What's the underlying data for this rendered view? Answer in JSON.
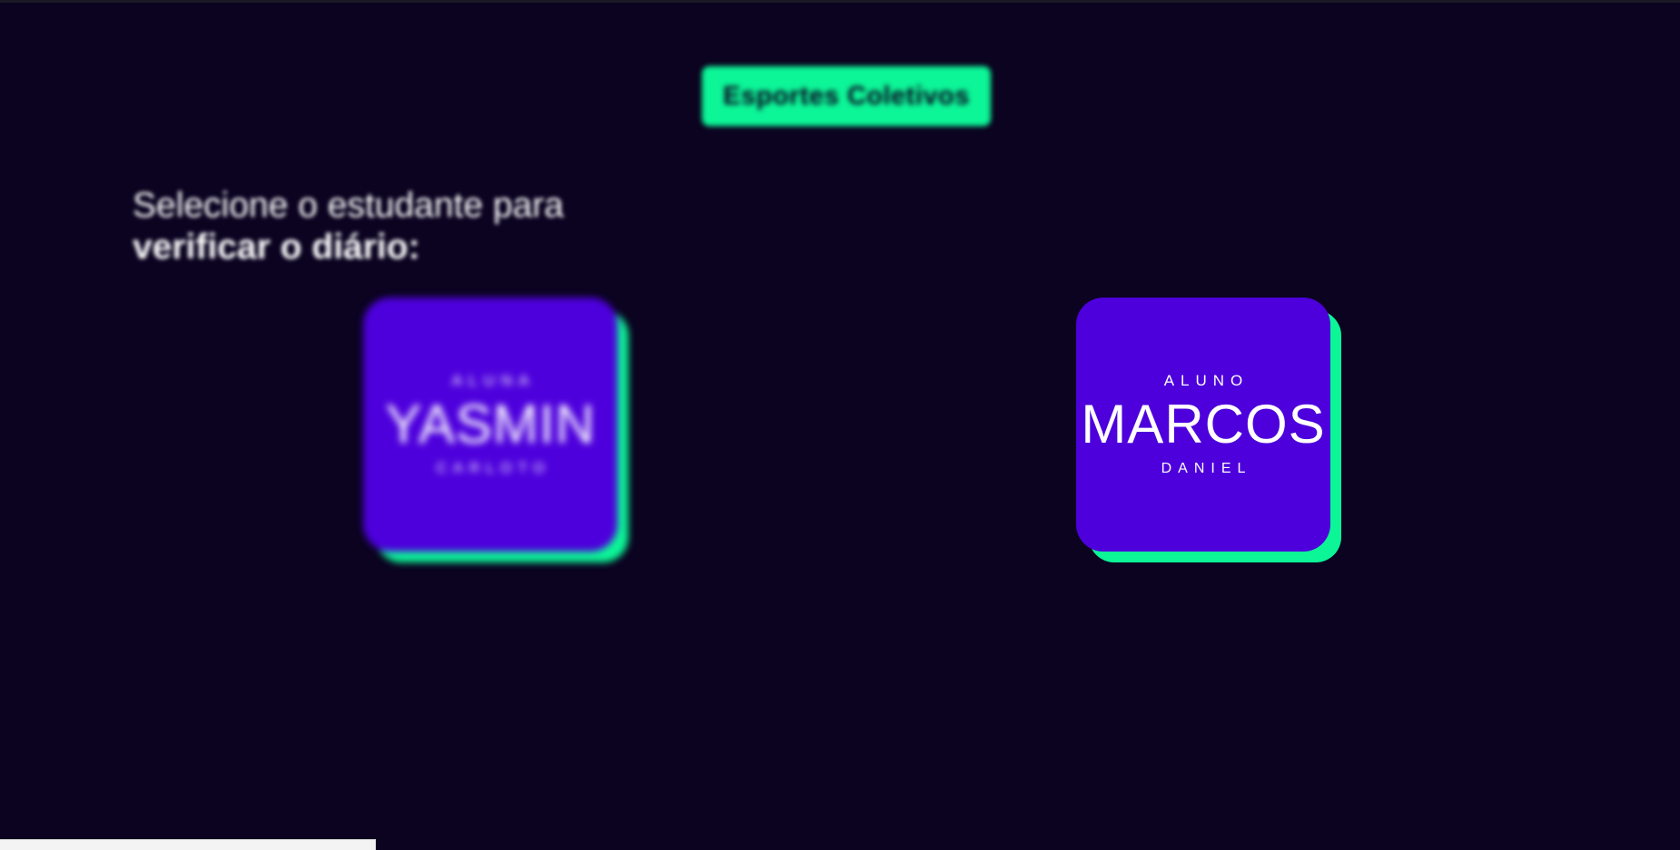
{
  "header": {
    "category_label": "Esportes Coletivos"
  },
  "prompt": {
    "line1": "Selecione o estudante para",
    "line2": "verificar o diário:"
  },
  "students": [
    {
      "role": "ALUNA",
      "first_name": "YASMIN",
      "last_name": "CARLOTO",
      "focused": false
    },
    {
      "role": "ALUNO",
      "first_name": "MARCOS",
      "last_name": "DANIEL",
      "focused": true
    }
  ],
  "status_bar": {
    "url_text": ""
  },
  "colors": {
    "background": "#0b0320",
    "accent_green": "#0cf597",
    "card_purple": "#4d00dc",
    "text_white": "#ffffff"
  }
}
